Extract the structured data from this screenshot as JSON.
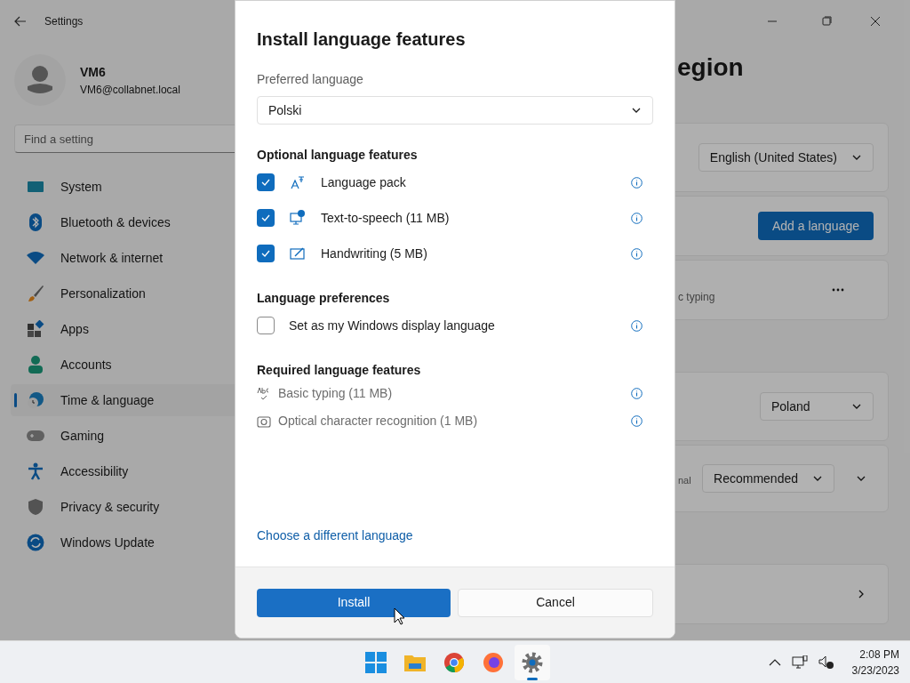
{
  "window": {
    "title": "Settings"
  },
  "user": {
    "name": "VM6",
    "email": "VM6@collabnet.local"
  },
  "search": {
    "placeholder": "Find a setting"
  },
  "sidebar": {
    "items": [
      {
        "label": "System",
        "selected": false
      },
      {
        "label": "Bluetooth & devices",
        "selected": false
      },
      {
        "label": "Network & internet",
        "selected": false
      },
      {
        "label": "Personalization",
        "selected": false
      },
      {
        "label": "Apps",
        "selected": false
      },
      {
        "label": "Accounts",
        "selected": false
      },
      {
        "label": "Time & language",
        "selected": true
      },
      {
        "label": "Gaming",
        "selected": false
      },
      {
        "label": "Accessibility",
        "selected": false
      },
      {
        "label": "Privacy & security",
        "selected": false
      },
      {
        "label": "Windows Update",
        "selected": false
      }
    ]
  },
  "page": {
    "title": "egion",
    "cards": [
      {
        "kind": "dropdown",
        "value": "English (United States)"
      },
      {
        "kind": "button",
        "label": "Add a language"
      },
      {
        "kind": "more",
        "text": "c typing"
      },
      {
        "kind": "gap"
      },
      {
        "kind": "dropdown",
        "value": "Poland"
      },
      {
        "kind": "expand",
        "text": "nal",
        "value": "Recommended"
      },
      {
        "kind": "gap"
      },
      {
        "kind": "link"
      }
    ]
  },
  "dialog": {
    "title": "Install language features",
    "preferred_language": {
      "label": "Preferred language",
      "value": "Polski"
    },
    "sections": [
      {
        "kind": "checklist",
        "heading": "Optional language features",
        "items": [
          {
            "label": "Language pack",
            "checked": true
          },
          {
            "label": "Text-to-speech (11 MB)",
            "checked": true
          },
          {
            "label": "Handwriting (5 MB)",
            "checked": true
          }
        ]
      },
      {
        "kind": "plain-checklist",
        "heading": "Language preferences",
        "items": [
          {
            "label": "Set as my Windows display language",
            "checked": false
          }
        ]
      },
      {
        "kind": "required",
        "heading": "Required language features",
        "items": [
          {
            "label": "Basic typing (11 MB)"
          },
          {
            "label": "Optical character recognition (1 MB)"
          }
        ]
      }
    ],
    "link": "Choose a different language",
    "buttons": [
      {
        "label": "Install",
        "kind": "primary"
      },
      {
        "label": "Cancel",
        "kind": "secondary"
      }
    ]
  },
  "taskbar": {
    "apps": [
      {
        "selected": false
      },
      {
        "selected": false
      },
      {
        "selected": false
      },
      {
        "selected": false
      },
      {
        "selected": true
      }
    ],
    "time": "2:08 PM",
    "date": "3/23/2023"
  }
}
